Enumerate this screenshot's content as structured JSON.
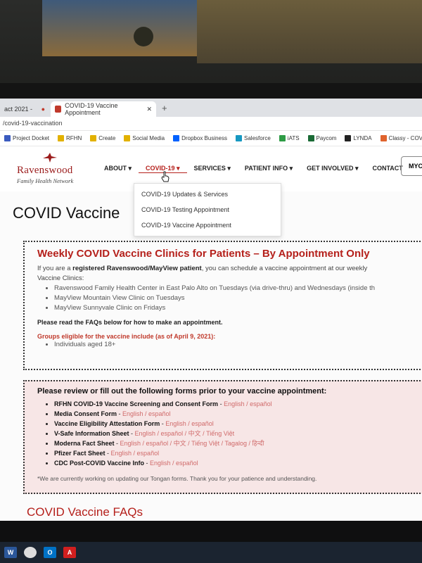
{
  "browser": {
    "tabs": [
      {
        "label": "act 2021 -"
      },
      {
        "label": "COVID-19 Vaccine Appointment"
      }
    ],
    "new_tab": "+",
    "url": "/covid-19-vaccination",
    "bookmarks": [
      {
        "label": "Project Docket",
        "color": "#3b5bbf"
      },
      {
        "label": "RFHN",
        "color": "#e2b100"
      },
      {
        "label": "Create",
        "color": "#e2b100"
      },
      {
        "label": "Social Media",
        "color": "#e2b100"
      },
      {
        "label": "Dropbox Business",
        "color": "#0061fe"
      },
      {
        "label": "Salesforce",
        "color": "#1798c1"
      },
      {
        "label": "iATS",
        "color": "#2e9b45"
      },
      {
        "label": "Paycom",
        "color": "#1a6a35"
      },
      {
        "label": "LYNDA",
        "color": "#222222"
      },
      {
        "label": "Classy - COVID",
        "color": "#e0632d"
      }
    ]
  },
  "site": {
    "logo_name": "Ravenswood",
    "logo_sub": "Family Health Network",
    "nav": [
      {
        "label": "ABOUT ▾"
      },
      {
        "label": "COVID-19 ▾"
      },
      {
        "label": "SERVICES ▾"
      },
      {
        "label": "PATIENT INFO ▾"
      },
      {
        "label": "GET INVOLVED ▾"
      },
      {
        "label": "CONTACT"
      }
    ],
    "my_button": "MYC",
    "dropdown": [
      "COVID-19 Updates & Services",
      "COVID-19 Testing Appointment",
      "COVID-19 Vaccine Appointment"
    ]
  },
  "main": {
    "title": "COVID Vaccine",
    "clinics": {
      "heading": "Weekly COVID Vaccine Clinics for Patients – By Appointment Only",
      "intro_pre": "If you are a ",
      "intro_bold": "registered Ravenswood/MayView patient",
      "intro_post": ", you can schedule a vaccine appointment at our weekly",
      "intro_line2": "Vaccine Clinics:",
      "list": [
        "Ravenswood Family Health Center in East Palo Alto on Tuesdays (via drive-thru) and Wednesdays (inside th",
        "MayView Mountain View Clinic on Tuesdays",
        "MayView Sunnyvale Clinic on Fridays"
      ],
      "read_faq": "Please read the FAQs below for how to make an appointment.",
      "groups_heading": "Groups eligible for the vaccine include (as of April 9, 2021):",
      "groups": [
        "Individuals aged 18+"
      ]
    },
    "forms": {
      "heading": "Please review or fill out the following forms prior to your vaccine appointment:",
      "items": [
        {
          "name": "RFHN COVID-19 Vaccine Screening and Consent Form",
          "links": "English / español"
        },
        {
          "name": "Media Consent Form",
          "links": "English / español"
        },
        {
          "name": "Vaccine Eligibility Attestation Form",
          "links": "English / español"
        },
        {
          "name": "V-Safe Information Sheet",
          "links": "English / español / 中文 / Tiếng Việt"
        },
        {
          "name": "Moderna Fact Sheet",
          "links": "English / español / 中文 / Tiếng Việt / Tagalog / हिन्दी"
        },
        {
          "name": "Pfizer Fact Sheet",
          "links": "English / español"
        },
        {
          "name": "CDC Post-COVID Vaccine Info",
          "links": "English /  español"
        }
      ],
      "note": "*We are currently working on updating our Tongan forms. Thank you for your patience and understanding."
    },
    "faqs_title": "COVID Vaccine FAQs"
  },
  "taskbar": [
    {
      "icon": "word-icon",
      "label": "W",
      "color": "#2b579a"
    },
    {
      "icon": "chrome-icon",
      "label": "",
      "color": "#dddddd"
    },
    {
      "icon": "outlook-icon",
      "label": "O",
      "color": "#0072c6"
    },
    {
      "icon": "acrobat-icon",
      "label": "A",
      "color": "#d11f1f"
    }
  ],
  "colors": {
    "brand_red": "#b5201b",
    "link_pink": "#d06a6a"
  }
}
